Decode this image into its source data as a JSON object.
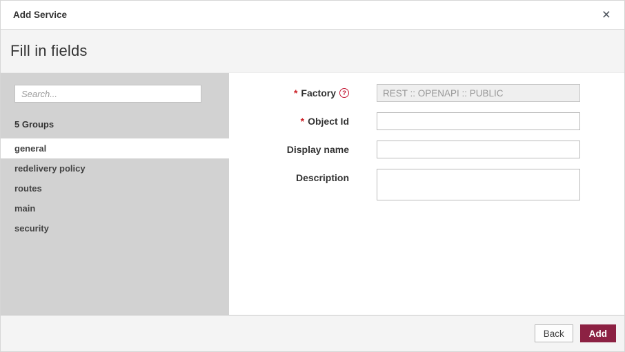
{
  "dialog": {
    "title": "Add Service",
    "subtitle": "Fill in fields",
    "close_glyph": "×"
  },
  "sidebar": {
    "search_placeholder": "Search...",
    "groups_count_label": "5 Groups",
    "items": [
      {
        "label": "general",
        "selected": true
      },
      {
        "label": "redelivery policy",
        "selected": false
      },
      {
        "label": "routes",
        "selected": false
      },
      {
        "label": "main",
        "selected": false
      },
      {
        "label": "security",
        "selected": false
      }
    ]
  },
  "form": {
    "required_marker": "*",
    "help_glyph": "?",
    "fields": [
      {
        "label": "Factory",
        "required": true,
        "has_help": true,
        "value": "REST :: OPENAPI :: PUBLIC",
        "disabled": true,
        "type": "text"
      },
      {
        "label": "Object Id",
        "required": true,
        "has_help": false,
        "value": "",
        "disabled": false,
        "type": "text"
      },
      {
        "label": "Display name",
        "required": false,
        "has_help": false,
        "value": "",
        "disabled": false,
        "type": "text"
      },
      {
        "label": "Description",
        "required": false,
        "has_help": false,
        "value": "",
        "disabled": false,
        "type": "textarea"
      }
    ]
  },
  "footer": {
    "back_label": "Back",
    "add_label": "Add"
  },
  "colors": {
    "accent": "#8c2143",
    "required_asterisk": "#cc2127",
    "help_icon": "#c41734",
    "sidebar_bg": "#d2d2d2",
    "band_bg": "#f4f4f4",
    "disabled_input_bg": "#efefef"
  }
}
